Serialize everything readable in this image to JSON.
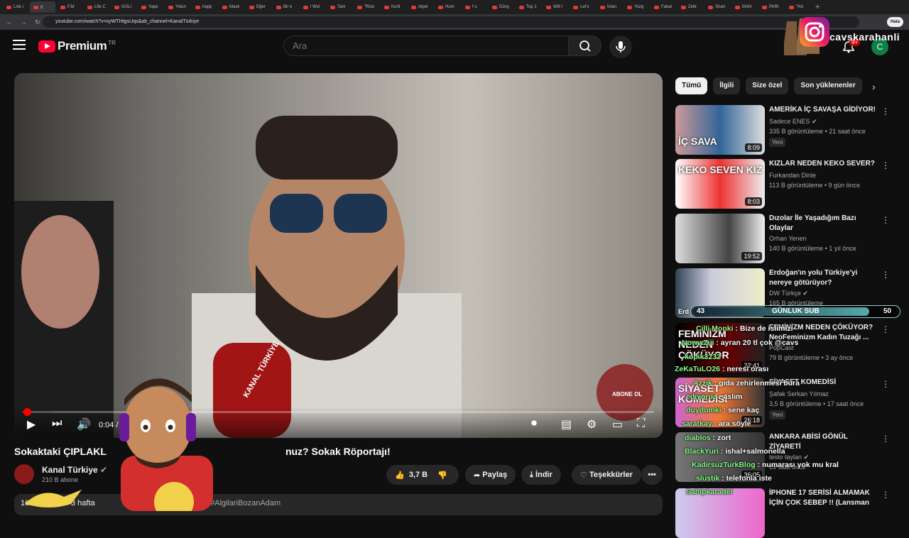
{
  "browser": {
    "tabs": [
      "Link i",
      "g",
      "F.M",
      "Life C",
      "GÜLI",
      "Yape",
      "Yolun",
      "happ",
      "Mask",
      "Eğer",
      "Bir e",
      "l Wol",
      "Tam",
      "\"Rize",
      "Kurtl",
      "Alper",
      "Hum",
      "f o",
      "Düny",
      "Top 1",
      "Will I",
      "Let's",
      "İstan",
      "Yozg",
      "Fakat",
      "Zeltr",
      "Shari",
      "MAN",
      "PARI",
      "\"HA"
    ],
    "url": "youtube.com/watch?v=syWTHtgsUqs&ab_channel=KanalTürkiye",
    "error_label": "Hata"
  },
  "masthead": {
    "logo": "Premium",
    "country": "TR",
    "search_placeholder": "Ara",
    "notif_count": "9+",
    "avatar_letter": "C"
  },
  "overlay": {
    "handle": "cavskarahanli",
    "sub_goal_current": "43",
    "sub_goal_label": "GÜNLUK SUB",
    "sub_goal_target": "50"
  },
  "player": {
    "time": "0:04 / 8",
    "logo_text": "ABONE OL",
    "mic_text": "KANAL TÜRKİYE"
  },
  "video": {
    "title": "Sokaktaki ÇIPLAKL",
    "title_end": "nuz? Sokak Röportajı!",
    "channel": "Kanal Türkiye",
    "subs": "210 B abone",
    "likes": "3,7 B",
    "share": "Paylaş",
    "download": "İndir",
    "thanks": "Teşekkürler",
    "views": "165 B g",
    "age": "3 hafta",
    "hashtag": "#AlgilariBozanAdam"
  },
  "chips": [
    "Tümü",
    "İlgili",
    "Size özel",
    "Son yüklenenler"
  ],
  "sidebar": [
    {
      "title": "AMERİKA İÇ SAVAŞA GİDİYOR!",
      "channel": "Sadece ENES",
      "meta": "335 B görüntüleme • 21 saat önce",
      "badge": "Yeni",
      "duration": "8:09",
      "thumb_text": "İÇ SAVA"
    },
    {
      "title": "KIZLAR NEDEN KEKO SEVER?",
      "channel": "Furkandan Dinle",
      "meta": "113 B görüntüleme • 9 gün önce",
      "duration": "8:03",
      "thumb_text": "KEKO SEVEN KIZ"
    },
    {
      "title": "Dızolar İle Yaşadığım Bazı Olaylar",
      "channel": "Orhan Yenen",
      "meta": "140 B görüntüleme • 1 yıl önce",
      "duration": "19:52"
    },
    {
      "title": "Erdoğan'ın yolu Türkiye'yi nereye götürüyor?",
      "channel": "DW Türkçe",
      "meta": "165 B görüntüleme",
      "thumb_text": "Erd"
    },
    {
      "title": "FEMİNİZM NEDEN ÇÖKÜYOR? NeoFeminizm Kadın Tuzağı ...",
      "channel": "PopCast",
      "meta": "79 B görüntüleme • 3 ay önce",
      "duration": "22:41",
      "thumb_text": "FEMİNİZM NEDEN ÇÖKÜYOR"
    },
    {
      "title": "SİYASET KOMEDİSİ",
      "channel": "Şafak Serkan Yılmaz",
      "meta": "3,5 B görüntüleme • 17 saat önce",
      "badge": "Yeni",
      "duration": "26:18",
      "thumb_text": "SİYASET KOMEDİSİ"
    },
    {
      "title": "ANKARA ABİSİ GÖNÜL ZİYARETİ",
      "channel": "testo taylan",
      "meta": "19 saat önce",
      "duration": "36:05"
    },
    {
      "title": "İPHONE 17 SERİSİ ALMAMAK İÇİN ÇOK SEBEP !! (Lansman ...",
      "channel": "",
      "meta": ""
    }
  ],
  "chat": [
    {
      "user": "Cilli Monki",
      "msg": "Bize de islimizi"
    },
    {
      "user": "NowwZiii",
      "msg": "ayran 20 tl çok @cavs"
    },
    {
      "user": "kopik3232",
      "msg": ""
    },
    {
      "user": "ZeKaTuLO26",
      "msg": "neresi orası"
    },
    {
      "user": "Azzik",
      "msg": "gıda zehirlenmesi bura"
    },
    {
      "user": "ediyoruz",
      "msg": "aslım"
    },
    {
      "user": "duydumki",
      "msg": "sene kaç"
    },
    {
      "user": "saratkay",
      "msg": "ara söyle"
    },
    {
      "user": "diablos",
      "msg": "zort"
    },
    {
      "user": "BlackYuri",
      "msg": "ishal+salmonella"
    },
    {
      "user": "KadirsuzTurkBlog",
      "msg": "numarası yok mu kral"
    },
    {
      "user": "slustik",
      "msg": "telefonla iste"
    },
    {
      "user": "Sahipkaradel",
      "msg": ""
    }
  ]
}
